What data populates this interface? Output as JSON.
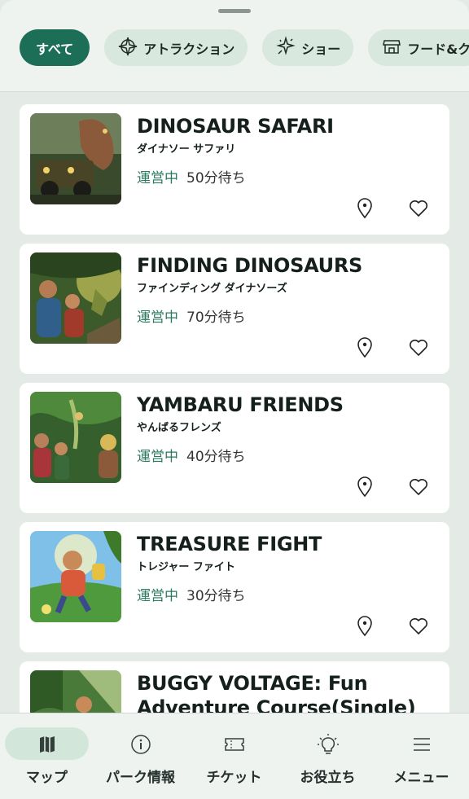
{
  "filters": [
    {
      "label": "すべて",
      "icon": "",
      "active": true
    },
    {
      "label": "アトラクション",
      "icon": "compass-icon"
    },
    {
      "label": "ショー",
      "icon": "sparkle-icon"
    },
    {
      "label": "フード&ク",
      "icon": "store-icon"
    }
  ],
  "attractions": [
    {
      "title": "DINOSAUR SAFARI",
      "subtitle": "ダイナソー サファリ",
      "status": "運営中",
      "wait": "50分待ち"
    },
    {
      "title": "FINDING DINOSAURS",
      "subtitle": "ファインディング ダイナソーズ",
      "status": "運営中",
      "wait": "70分待ち"
    },
    {
      "title": "YAMBARU FRIENDS",
      "subtitle": "やんばるフレンズ",
      "status": "運営中",
      "wait": "40分待ち"
    },
    {
      "title": "TREASURE FIGHT",
      "subtitle": "トレジャー ファイト",
      "status": "運営中",
      "wait": "30分待ち"
    },
    {
      "title": "BUGGY VOLTAGE: Fun Adventure Course(Single)",
      "subtitle": "",
      "status": "",
      "wait": ""
    }
  ],
  "tabs": [
    {
      "label": "マップ",
      "icon": "map-icon",
      "active": true
    },
    {
      "label": "パーク情報",
      "icon": "info-icon"
    },
    {
      "label": "チケット",
      "icon": "ticket-icon"
    },
    {
      "label": "お役立ち",
      "icon": "lightbulb-icon"
    },
    {
      "label": "メニュー",
      "icon": "menu-icon"
    }
  ],
  "colors": {
    "accent": "#1d6e57",
    "status": "#2a7a60",
    "chip_bg": "#d8e8de"
  }
}
